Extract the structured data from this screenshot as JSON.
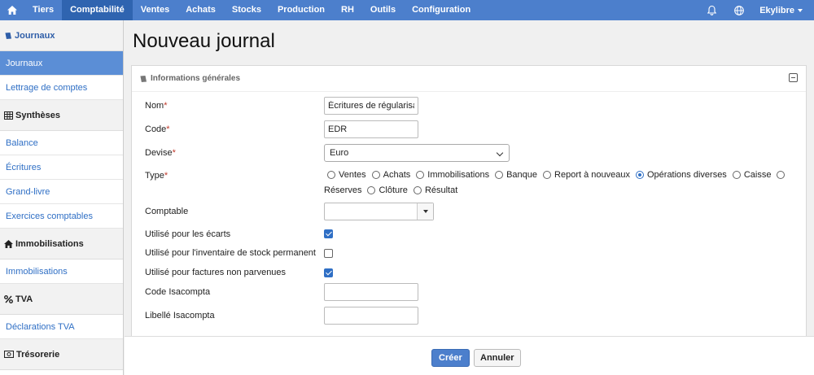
{
  "topnav": {
    "items": [
      {
        "label": "Tiers",
        "active": false
      },
      {
        "label": "Comptabilité",
        "active": true
      },
      {
        "label": "Ventes",
        "active": false
      },
      {
        "label": "Achats",
        "active": false
      },
      {
        "label": "Stocks",
        "active": false
      },
      {
        "label": "Production",
        "active": false
      },
      {
        "label": "RH",
        "active": false
      },
      {
        "label": "Outils",
        "active": false
      },
      {
        "label": "Configuration",
        "active": false
      }
    ],
    "user": "Ekylibre",
    "icons": {
      "home": "home-icon",
      "bell": "bell-icon",
      "globe": "globe-icon"
    },
    "colors": {
      "bar": "#4c7fcc",
      "active": "#2f64b0"
    }
  },
  "sidebar": {
    "sections": [
      {
        "title": "Journaux",
        "icon": "book-icon",
        "items": [
          {
            "label": "Journaux",
            "active": true
          },
          {
            "label": "Lettrage de comptes",
            "active": false
          }
        ]
      },
      {
        "title": "Synthèses",
        "icon": "table-icon",
        "items": [
          {
            "label": "Balance",
            "active": false
          },
          {
            "label": "Écritures",
            "active": false
          },
          {
            "label": "Grand-livre",
            "active": false
          },
          {
            "label": "Exercices comptables",
            "active": false
          }
        ]
      },
      {
        "title": "Immobilisations",
        "icon": "house-icon",
        "items": [
          {
            "label": "Immobilisations",
            "active": false
          }
        ]
      },
      {
        "title": "TVA",
        "icon": "percent-icon",
        "items": [
          {
            "label": "Déclarations TVA",
            "active": false
          }
        ]
      },
      {
        "title": "Trésorerie",
        "icon": "banknote-icon",
        "items": []
      }
    ]
  },
  "page": {
    "title": "Nouveau journal",
    "panel_title": "Informations générales"
  },
  "form": {
    "nom_label": "Nom",
    "nom_value": "Écritures de régularisation",
    "code_label": "Code",
    "code_value": "EDR",
    "devise_label": "Devise",
    "devise_value": "Euro",
    "type_label": "Type",
    "types_line1": [
      {
        "label": "Ventes",
        "checked": false
      },
      {
        "label": "Achats",
        "checked": false
      },
      {
        "label": "Immobilisations",
        "checked": false
      },
      {
        "label": "Banque",
        "checked": false
      },
      {
        "label": "Report à nouveaux",
        "checked": false
      },
      {
        "label": "Opérations diverses",
        "checked": true
      },
      {
        "label": "Caisse",
        "checked": false
      },
      {
        "label": "",
        "checked": false
      }
    ],
    "types_line2": [
      {
        "label": "Réserves",
        "checked": false,
        "no_radio": true
      },
      {
        "label": "Clôture",
        "checked": false
      },
      {
        "label": "Résultat",
        "checked": false
      }
    ],
    "comptable_label": "Comptable",
    "comptable_value": "",
    "ecarts_label": "Utilisé pour les écarts",
    "ecarts_checked": true,
    "inventaire_label": "Utilisé pour l'inventaire de stock permanent",
    "inventaire_checked": false,
    "factures_label": "Utilisé pour factures non parvenues",
    "factures_checked": true,
    "isacompta_code_label": "Code Isacompta",
    "isacompta_code_value": "",
    "isacompta_libelle_label": "Libellé Isacompta",
    "isacompta_libelle_value": ""
  },
  "actions": {
    "create": "Créer",
    "cancel": "Annuler"
  }
}
